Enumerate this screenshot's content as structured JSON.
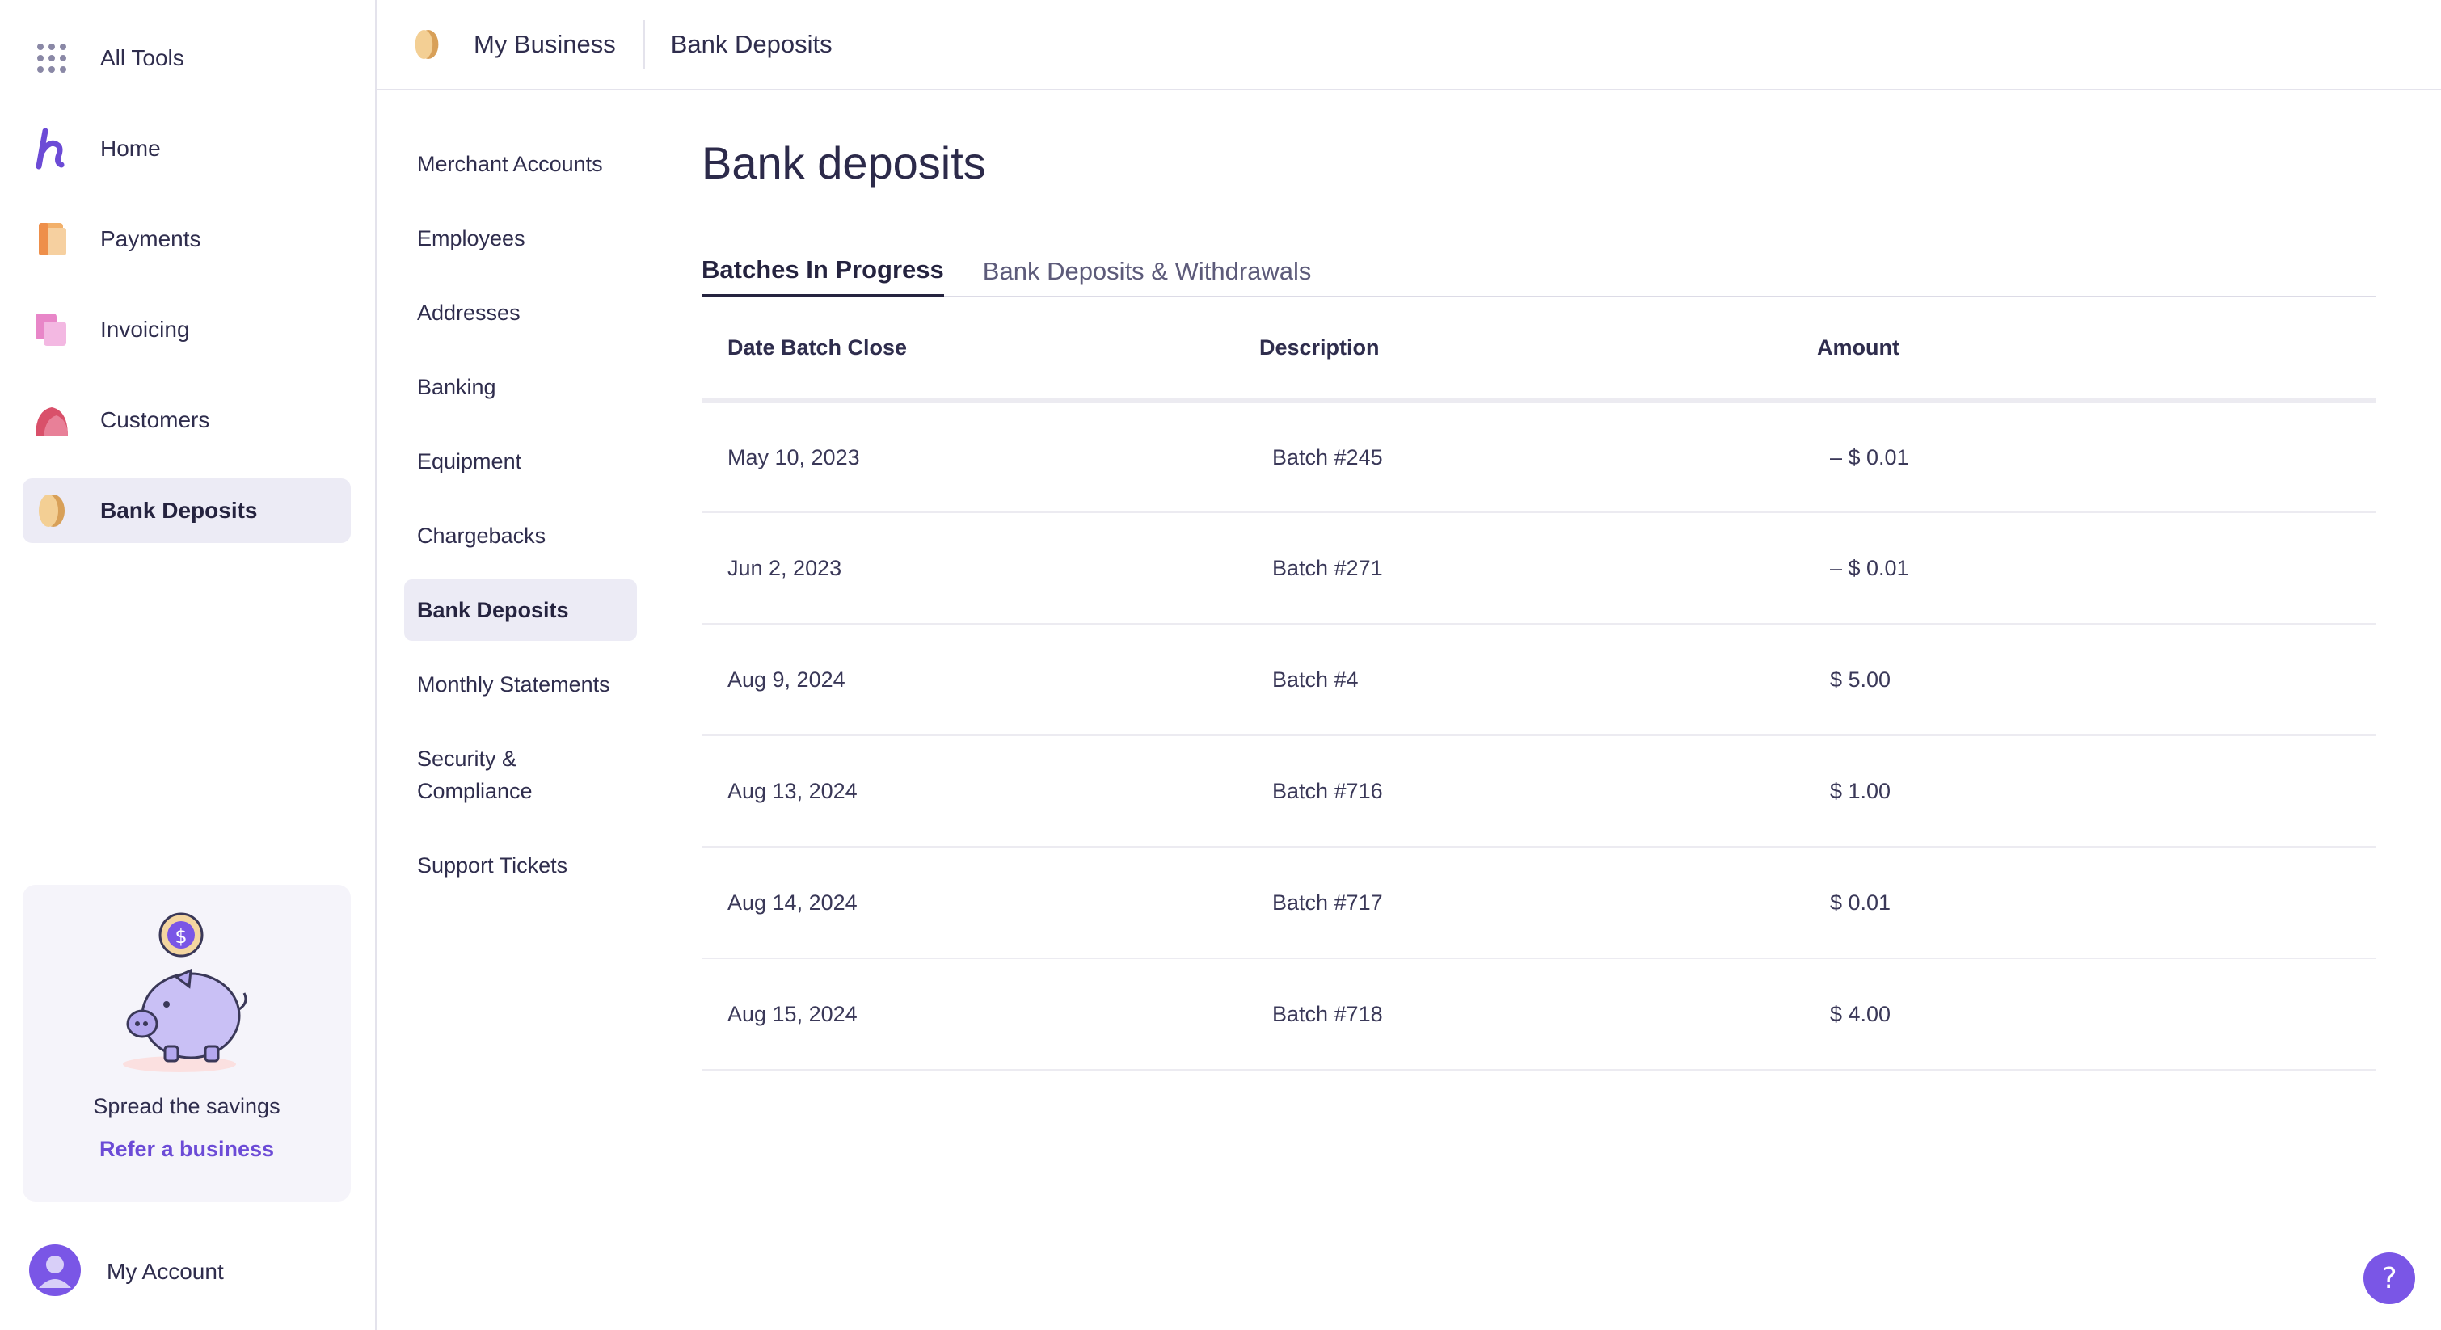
{
  "sidebar": {
    "items": [
      {
        "label": "All Tools",
        "icon": "grid-icon"
      },
      {
        "label": "Home",
        "icon": "home-logo-icon"
      },
      {
        "label": "Payments",
        "icon": "payments-icon"
      },
      {
        "label": "Invoicing",
        "icon": "invoicing-icon"
      },
      {
        "label": "Customers",
        "icon": "customers-icon"
      },
      {
        "label": "Bank Deposits",
        "icon": "bank-deposits-icon",
        "active": true
      }
    ],
    "promo": {
      "text": "Spread the savings",
      "link": "Refer a business"
    },
    "account": {
      "label": "My Account"
    }
  },
  "topbar": {
    "crumb1": "My Business",
    "crumb2": "Bank Deposits"
  },
  "subnav": [
    "Merchant Accounts",
    "Employees",
    "Addresses",
    "Banking",
    "Equipment",
    "Chargebacks",
    "Bank Deposits",
    "Monthly Statements",
    "Security & Compliance",
    "Support Tickets"
  ],
  "page": {
    "title": "Bank deposits",
    "tabs": [
      "Batches In Progress",
      "Bank Deposits & Withdrawals"
    ]
  },
  "table": {
    "headers": [
      "Date Batch Close",
      "Description",
      "Amount"
    ],
    "rows": [
      [
        "May 10, 2023",
        "Batch #245",
        "– $ 0.01"
      ],
      [
        "Jun 2, 2023",
        "Batch #271",
        "– $ 0.01"
      ],
      [
        "Aug 9, 2024",
        "Batch #4",
        "$ 5.00"
      ],
      [
        "Aug 13, 2024",
        "Batch #716",
        "$ 1.00"
      ],
      [
        "Aug 14, 2024",
        "Batch #717",
        "$ 0.01"
      ],
      [
        "Aug 15, 2024",
        "Batch #718",
        "$ 4.00"
      ]
    ]
  },
  "help": {
    "label": "?"
  },
  "colors": {
    "accent": "#7a56e6",
    "link": "#6c4bd6",
    "active_bg": "#ecebf5",
    "text": "#2c2a4a"
  }
}
